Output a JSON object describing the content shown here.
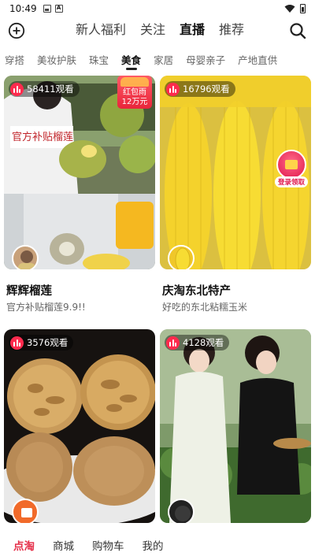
{
  "status_bar": {
    "time": "10:49",
    "icons": [
      "image-icon",
      "font-icon",
      "wifi-icon",
      "battery-icon"
    ]
  },
  "top_nav": {
    "tabs": [
      {
        "label": "新人福利"
      },
      {
        "label": "关注"
      },
      {
        "label": "直播",
        "active": true
      },
      {
        "label": "推荐"
      }
    ]
  },
  "categories": [
    {
      "label": "穿搭"
    },
    {
      "label": "美妆护肤"
    },
    {
      "label": "珠宝"
    },
    {
      "label": "美食",
      "active": true
    },
    {
      "label": "家居"
    },
    {
      "label": "母婴亲子"
    },
    {
      "label": "产地直供"
    }
  ],
  "cards": [
    {
      "viewers": "58411观看",
      "title": "辉辉榴莲",
      "subtitle": "官方补贴榴莲9.9!!",
      "redpacket": {
        "line1": "红包雨",
        "line2": "12万元"
      }
    },
    {
      "viewers": "16796观看",
      "title": "庆淘东北特产",
      "subtitle": "好吃的东北粘糯玉米",
      "claim_label": "登录领取"
    },
    {
      "viewers": "3576观看",
      "title": "",
      "subtitle": ""
    },
    {
      "viewers": "4128观看",
      "title": "",
      "subtitle": ""
    }
  ],
  "bottom_nav": [
    {
      "label": "点淘",
      "active": true
    },
    {
      "label": "商城"
    },
    {
      "label": "购物车"
    },
    {
      "label": "我的"
    }
  ],
  "colors": {
    "accent": "#e5304a",
    "live_badge": "#ff2a4d"
  }
}
